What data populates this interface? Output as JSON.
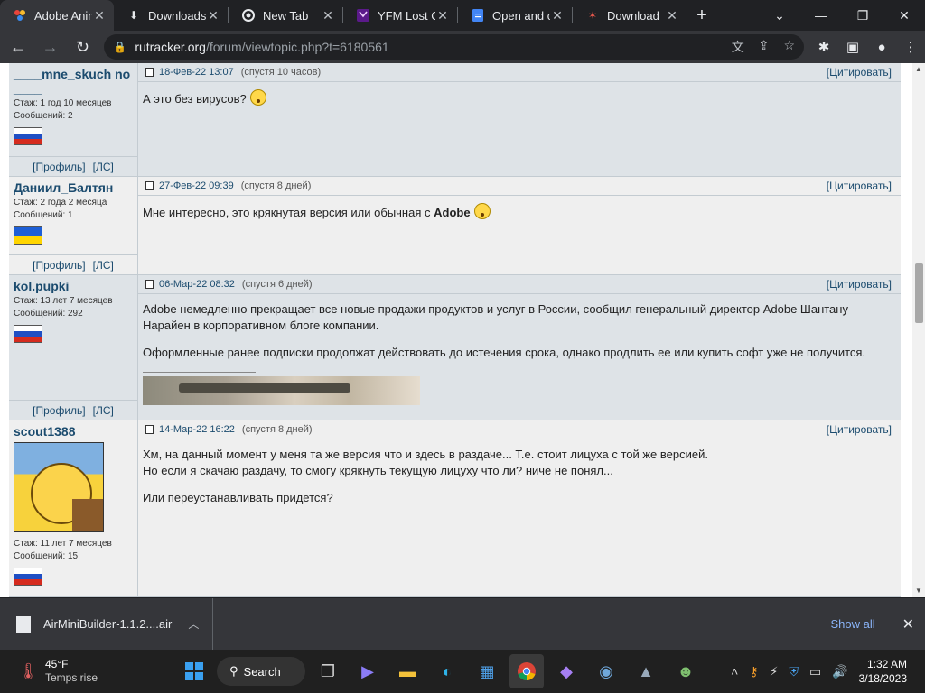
{
  "tabs": [
    {
      "title": "Adobe Anim",
      "favicon": "rutracker-icon",
      "active": true
    },
    {
      "title": "Downloads",
      "favicon": "download-icon",
      "active": false
    },
    {
      "title": "New Tab",
      "favicon": "chrome-icon",
      "active": false
    },
    {
      "title": "YFM Lost C",
      "favicon": "yfm-icon",
      "active": false
    },
    {
      "title": "Open and c",
      "favicon": "docs-icon",
      "active": false
    },
    {
      "title": "Download",
      "favicon": "star-icon",
      "active": false
    }
  ],
  "toolbar": {
    "url_host": "rutracker.org",
    "url_path": "/forum/viewtopic.php?t=6180561"
  },
  "posts": [
    {
      "username": "____mne_skuch no____",
      "stazh": "Стаж: 1 год 10 месяцев",
      "messages": "Сообщений: 2",
      "flag": "ru",
      "date": "18-Фев-22 13:07",
      "since": "(спустя 10 часов)",
      "quote": "[Цитировать]",
      "text": [
        "А это без вирусов?"
      ],
      "links": {
        "profile": "[Профиль]",
        "pm": "[ЛС]"
      },
      "alt": true
    },
    {
      "username": "Даниил_Балтян",
      "stazh": "Стаж: 2 года 2 месяца",
      "messages": "Сообщений: 1",
      "flag": "ua",
      "date": "27-Фев-22 09:39",
      "since": "(спустя 8 дней)",
      "quote": "[Цитировать]",
      "text_prefix": "Мне интересно, это крякнутая версия или обычная с",
      "text_bold": "Adobe",
      "links": {
        "profile": "[Профиль]",
        "pm": "[ЛС]"
      },
      "alt": false
    },
    {
      "username": "kol.pupki",
      "stazh": "Стаж: 13 лет 7 месяцев",
      "messages": "Сообщений: 292",
      "flag": "ru",
      "date": "06-Мар-22 08:32",
      "since": "(спустя 6 дней)",
      "quote": "[Цитировать]",
      "text": [
        "Adobe немедленно прекращает все новые продажи продуктов и услуг в России, сообщил генеральный директор Adobe Шантану Нарайен в корпоративном блоге компании.",
        "Оформленные ранее подписки продолжат действовать до истечения срока, однако продлить ее или купить софт уже не получится."
      ],
      "links": {
        "profile": "[Профиль]",
        "pm": "[ЛС]"
      },
      "alt": true
    },
    {
      "username": "scout1388",
      "stazh": "Стаж: 11 лет 7 месяцев",
      "messages": "Сообщений: 15",
      "flag": "ru",
      "date": "14-Мар-22 16:22",
      "since": "(спустя 8 дней)",
      "quote": "[Цитировать]",
      "text": [
        "Хм, на данный момент у меня та же версия что и здесь в раздаче... Т.е. стоит лицуха с той же версией.",
        "Но если я скачаю раздачу, то смогу крякнуть текущую лицуху что ли? ниче не понял...",
        "Или переустанавливать придется?"
      ],
      "alt": false
    }
  ],
  "download_bar": {
    "filename": "AirMiniBuilder-1.1.2....air",
    "show_all": "Show all"
  },
  "taskbar": {
    "temp": "45°F",
    "weather_text": "Temps rise",
    "search_label": "Search",
    "time": "1:32 AM",
    "date": "3/18/2023"
  }
}
